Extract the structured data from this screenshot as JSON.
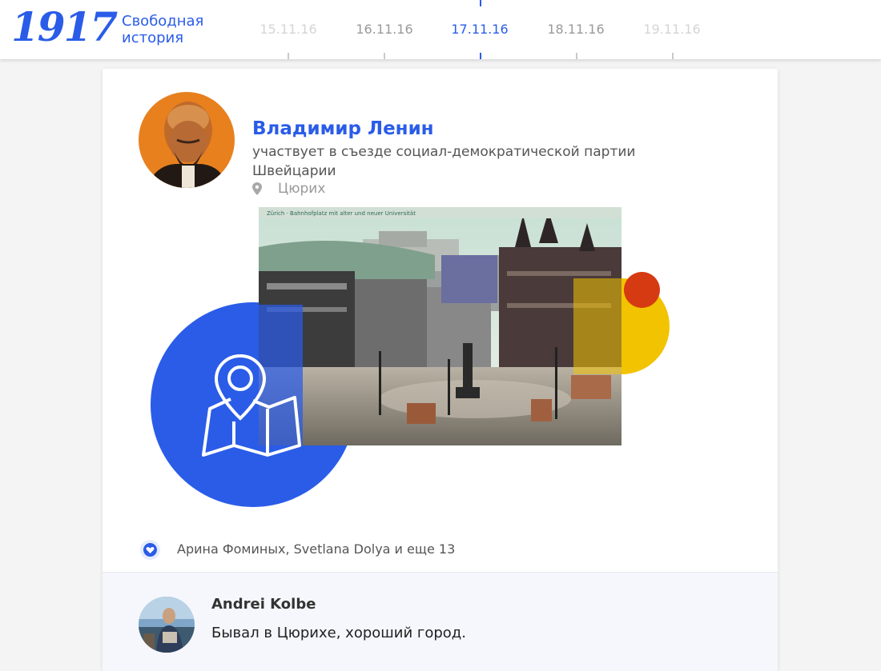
{
  "header": {
    "logo_mark": "1917",
    "logo_line1": "Свободная",
    "logo_line2": "история"
  },
  "timeline": {
    "dates": [
      "15.11.16",
      "16.11.16",
      "17.11.16",
      "18.11.16",
      "19.11.16"
    ],
    "active_date": "17.11.16"
  },
  "post": {
    "author": "Владимир Ленин",
    "event": "участвует в съезде социал-демократической партии Швейцарии",
    "location": "Цюрих",
    "photo_caption": "Zürich · Bahnhofplatz mit alter und neuer Universität",
    "likes": "Арина Фоминых, Svetlana Dolya и еще 13"
  },
  "comment": {
    "author": "Andrei Kolbe",
    "text": "Бывал в Цюрихе, хороший город."
  },
  "colors": {
    "brand_blue": "#2a5ce8",
    "yellow": "#f2c300",
    "red": "#d63a12",
    "avatar_orange": "#e8801e"
  },
  "icons": {
    "location": "location-pin-icon",
    "map": "map-icon",
    "like": "heart-icon"
  }
}
